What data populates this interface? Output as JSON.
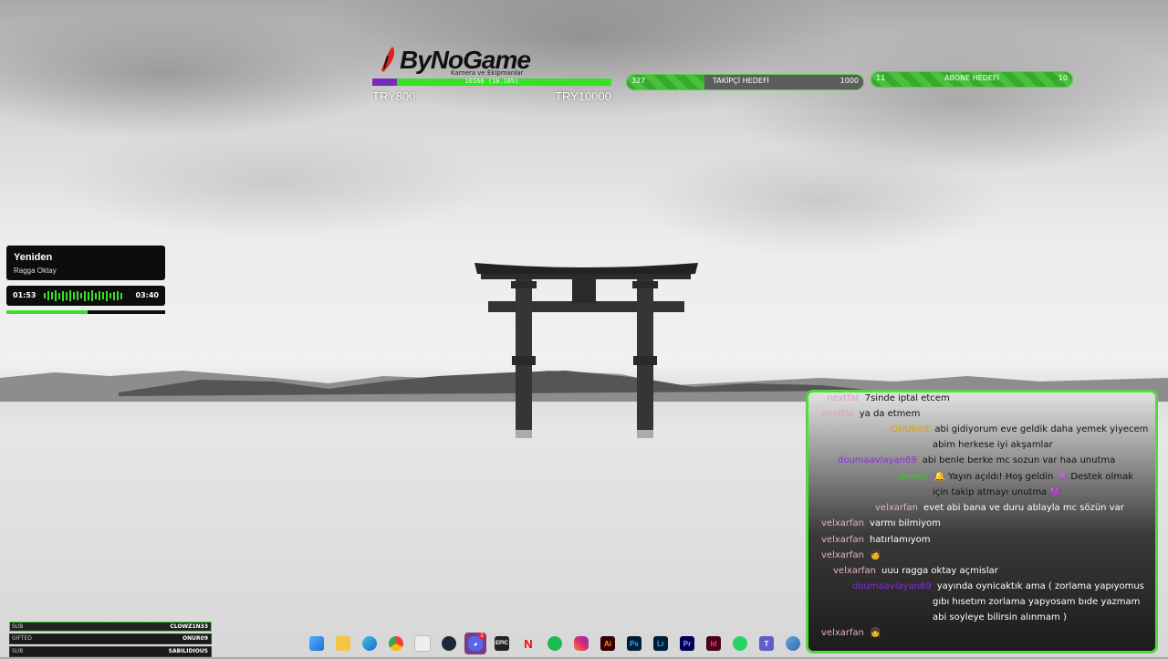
{
  "donation": {
    "logo_text": "ByNoGame",
    "subtitle": "Kamera ve Ekipmanlar",
    "progress_text": "10166 (10.16%)",
    "progress_fraction": 0.1016,
    "min_label": "TRY800",
    "max_label": "TRY10000",
    "colors": {
      "filled": "#39e028",
      "bar": "#7a2bbb"
    }
  },
  "follower_goal": {
    "current": "327",
    "label": "TAKİPÇİ HEDEFİ",
    "target": "1000",
    "fraction": 0.327
  },
  "sub_goal": {
    "current": "11",
    "label": "ABONE HEDEFİ",
    "target": "10",
    "fraction": 1.0
  },
  "music": {
    "title": "Yeniden",
    "artist": "Ragga Oktay",
    "elapsed": "01:53",
    "duration": "03:40",
    "progress_fraction": 0.51,
    "accent": "#39e028"
  },
  "chat": {
    "messages": [
      {
        "user": "nextfat",
        "text": "7sinde iptal etcem",
        "user_color": "#d9a0c0"
      },
      {
        "user": "nextfat",
        "text": "ya da etmem",
        "user_color": "#d9a0c0"
      },
      {
        "user": "ONUR09",
        "text": "abi gidiyorum eve geldik daha yemek yiyecem",
        "text2": "abim herkese iyi akşamlar",
        "user_color": "#e0a000"
      },
      {
        "user": "doumaavlayan69",
        "text": "abi benle berke mc sozun var haa unutma",
        "user_color": "#8a2be2"
      },
      {
        "user": "BotRix",
        "text": "🔔 Yayın açıldı! Hoş geldin 👾 Destek olmak",
        "text2": "için takip atmayı unutma 💜",
        "user_color": "#3ec42a"
      },
      {
        "user": "velxarfan",
        "text": "evet abi bana ve duru ablayla mc sözün var",
        "user_color": "#e8b0d0"
      },
      {
        "user": "velxarfan",
        "text": "varmı bilmiyom",
        "user_color": "#e8b0d0"
      },
      {
        "user": "velxarfan",
        "text": "hatırlamıyom",
        "user_color": "#e8b0d0"
      },
      {
        "user": "velxarfan",
        "text": "",
        "user_color": "#e8b0d0"
      },
      {
        "user": "velxarfan",
        "text": "uuu ragga oktay açmislar",
        "user_color": "#e8b0d0"
      },
      {
        "user": "doumaavlayan69",
        "text": "yayında oynicaktık ama ( zorlama yapıyomus",
        "text2": "gıbı hısetım zorlama yapyosam bıde yazmam",
        "text3": "abi soyleye bilirsin alınmam )",
        "user_color": "#8a2be2"
      },
      {
        "user": "velxarfan",
        "text": "",
        "user_color": "#e8b0d0"
      }
    ]
  },
  "events": [
    {
      "type": "SUB",
      "name": "CLOWZ1N33"
    },
    {
      "type": "GIFTED",
      "name": "ONUR09"
    },
    {
      "type": "SUB",
      "name": "SABILIDIOUS"
    }
  ],
  "taskbar": {
    "icons": [
      "windows-icon",
      "file-explorer-icon",
      "edge-icon",
      "chrome-icon",
      "store-icon",
      "steam-icon",
      "discord-icon",
      "epic-games-icon",
      "netflix-icon",
      "spotify-icon",
      "instagram-icon",
      "illustrator-icon",
      "photoshop-icon",
      "lightroom-icon",
      "premiere-icon",
      "indesign-icon",
      "whatsapp-icon",
      "teams-icon",
      "edge-dev-icon"
    ],
    "discord_badge": "1"
  }
}
